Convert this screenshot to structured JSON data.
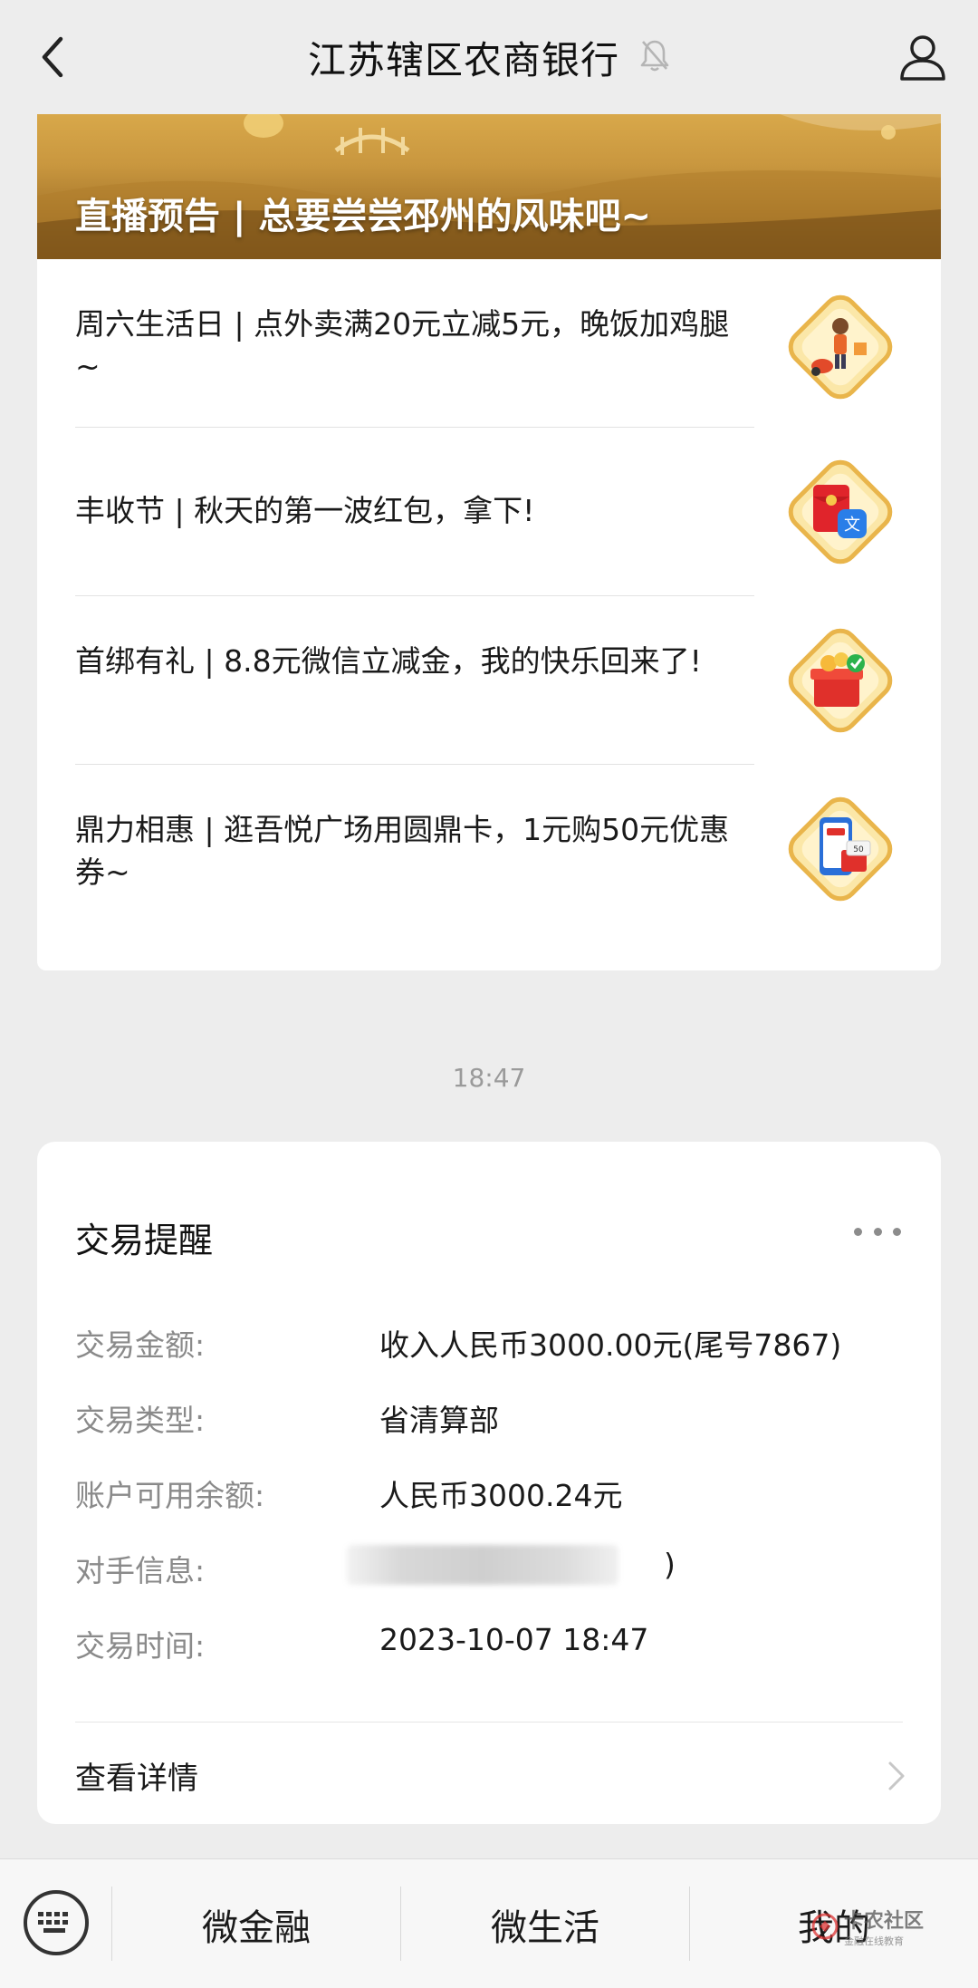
{
  "header": {
    "title": "江苏辖区农商银行"
  },
  "banner": {
    "title": "直播预告 | 总要尝尝邳州的风味吧~"
  },
  "articles": [
    {
      "title": "周六生活日 | 点外卖满20元立减5元，晚饭加鸡腿~"
    },
    {
      "title": "丰收节 | 秋天的第一波红包，拿下!"
    },
    {
      "title": "首绑有礼 | 8.8元微信立减金，我的快乐回来了!"
    },
    {
      "title": "鼎力相惠 | 逛吾悦广场用圆鼎卡，1元购50元优惠券~"
    }
  ],
  "timestamp": "18:47",
  "transaction": {
    "title": "交易提醒",
    "rows": [
      {
        "label": "交易金额:",
        "value": "收入人民币3000.00元(尾号7867)"
      },
      {
        "label": "交易类型:",
        "value": "省清算部"
      },
      {
        "label": "账户可用余额:",
        "value": "人民币3000.24元"
      },
      {
        "label": "对手信息:",
        "value": ")"
      },
      {
        "label": "交易时间:",
        "value": "2023-10-07 18:47"
      }
    ],
    "detail_label": "查看详情"
  },
  "bottom_menu": {
    "items": [
      "微金融",
      "微生活",
      "我的"
    ]
  },
  "watermark": {
    "main": "卡农社区",
    "sub": "金融在线教育"
  },
  "colors": {
    "background": "#ededed",
    "card": "#ffffff",
    "label_gray": "#8a8a8a",
    "banner_gold": "#c9973f"
  }
}
